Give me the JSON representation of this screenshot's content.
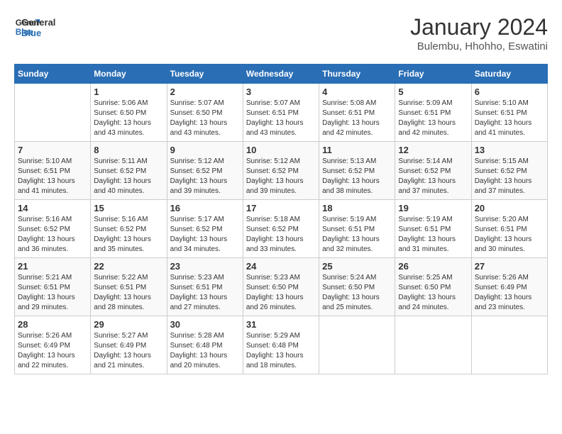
{
  "logo": {
    "text_general": "General",
    "text_blue": "Blue"
  },
  "title": "January 2024",
  "subtitle": "Bulembu, Hhohho, Eswatini",
  "headers": [
    "Sunday",
    "Monday",
    "Tuesday",
    "Wednesday",
    "Thursday",
    "Friday",
    "Saturday"
  ],
  "weeks": [
    [
      {
        "day": "",
        "info": ""
      },
      {
        "day": "1",
        "info": "Sunrise: 5:06 AM\nSunset: 6:50 PM\nDaylight: 13 hours\nand 43 minutes."
      },
      {
        "day": "2",
        "info": "Sunrise: 5:07 AM\nSunset: 6:50 PM\nDaylight: 13 hours\nand 43 minutes."
      },
      {
        "day": "3",
        "info": "Sunrise: 5:07 AM\nSunset: 6:51 PM\nDaylight: 13 hours\nand 43 minutes."
      },
      {
        "day": "4",
        "info": "Sunrise: 5:08 AM\nSunset: 6:51 PM\nDaylight: 13 hours\nand 42 minutes."
      },
      {
        "day": "5",
        "info": "Sunrise: 5:09 AM\nSunset: 6:51 PM\nDaylight: 13 hours\nand 42 minutes."
      },
      {
        "day": "6",
        "info": "Sunrise: 5:10 AM\nSunset: 6:51 PM\nDaylight: 13 hours\nand 41 minutes."
      }
    ],
    [
      {
        "day": "7",
        "info": "Sunrise: 5:10 AM\nSunset: 6:51 PM\nDaylight: 13 hours\nand 41 minutes."
      },
      {
        "day": "8",
        "info": "Sunrise: 5:11 AM\nSunset: 6:52 PM\nDaylight: 13 hours\nand 40 minutes."
      },
      {
        "day": "9",
        "info": "Sunrise: 5:12 AM\nSunset: 6:52 PM\nDaylight: 13 hours\nand 39 minutes."
      },
      {
        "day": "10",
        "info": "Sunrise: 5:12 AM\nSunset: 6:52 PM\nDaylight: 13 hours\nand 39 minutes."
      },
      {
        "day": "11",
        "info": "Sunrise: 5:13 AM\nSunset: 6:52 PM\nDaylight: 13 hours\nand 38 minutes."
      },
      {
        "day": "12",
        "info": "Sunrise: 5:14 AM\nSunset: 6:52 PM\nDaylight: 13 hours\nand 37 minutes."
      },
      {
        "day": "13",
        "info": "Sunrise: 5:15 AM\nSunset: 6:52 PM\nDaylight: 13 hours\nand 37 minutes."
      }
    ],
    [
      {
        "day": "14",
        "info": "Sunrise: 5:16 AM\nSunset: 6:52 PM\nDaylight: 13 hours\nand 36 minutes."
      },
      {
        "day": "15",
        "info": "Sunrise: 5:16 AM\nSunset: 6:52 PM\nDaylight: 13 hours\nand 35 minutes."
      },
      {
        "day": "16",
        "info": "Sunrise: 5:17 AM\nSunset: 6:52 PM\nDaylight: 13 hours\nand 34 minutes."
      },
      {
        "day": "17",
        "info": "Sunrise: 5:18 AM\nSunset: 6:52 PM\nDaylight: 13 hours\nand 33 minutes."
      },
      {
        "day": "18",
        "info": "Sunrise: 5:19 AM\nSunset: 6:51 PM\nDaylight: 13 hours\nand 32 minutes."
      },
      {
        "day": "19",
        "info": "Sunrise: 5:19 AM\nSunset: 6:51 PM\nDaylight: 13 hours\nand 31 minutes."
      },
      {
        "day": "20",
        "info": "Sunrise: 5:20 AM\nSunset: 6:51 PM\nDaylight: 13 hours\nand 30 minutes."
      }
    ],
    [
      {
        "day": "21",
        "info": "Sunrise: 5:21 AM\nSunset: 6:51 PM\nDaylight: 13 hours\nand 29 minutes."
      },
      {
        "day": "22",
        "info": "Sunrise: 5:22 AM\nSunset: 6:51 PM\nDaylight: 13 hours\nand 28 minutes."
      },
      {
        "day": "23",
        "info": "Sunrise: 5:23 AM\nSunset: 6:51 PM\nDaylight: 13 hours\nand 27 minutes."
      },
      {
        "day": "24",
        "info": "Sunrise: 5:23 AM\nSunset: 6:50 PM\nDaylight: 13 hours\nand 26 minutes."
      },
      {
        "day": "25",
        "info": "Sunrise: 5:24 AM\nSunset: 6:50 PM\nDaylight: 13 hours\nand 25 minutes."
      },
      {
        "day": "26",
        "info": "Sunrise: 5:25 AM\nSunset: 6:50 PM\nDaylight: 13 hours\nand 24 minutes."
      },
      {
        "day": "27",
        "info": "Sunrise: 5:26 AM\nSunset: 6:49 PM\nDaylight: 13 hours\nand 23 minutes."
      }
    ],
    [
      {
        "day": "28",
        "info": "Sunrise: 5:26 AM\nSunset: 6:49 PM\nDaylight: 13 hours\nand 22 minutes."
      },
      {
        "day": "29",
        "info": "Sunrise: 5:27 AM\nSunset: 6:49 PM\nDaylight: 13 hours\nand 21 minutes."
      },
      {
        "day": "30",
        "info": "Sunrise: 5:28 AM\nSunset: 6:48 PM\nDaylight: 13 hours\nand 20 minutes."
      },
      {
        "day": "31",
        "info": "Sunrise: 5:29 AM\nSunset: 6:48 PM\nDaylight: 13 hours\nand 18 minutes."
      },
      {
        "day": "",
        "info": ""
      },
      {
        "day": "",
        "info": ""
      },
      {
        "day": "",
        "info": ""
      }
    ]
  ]
}
